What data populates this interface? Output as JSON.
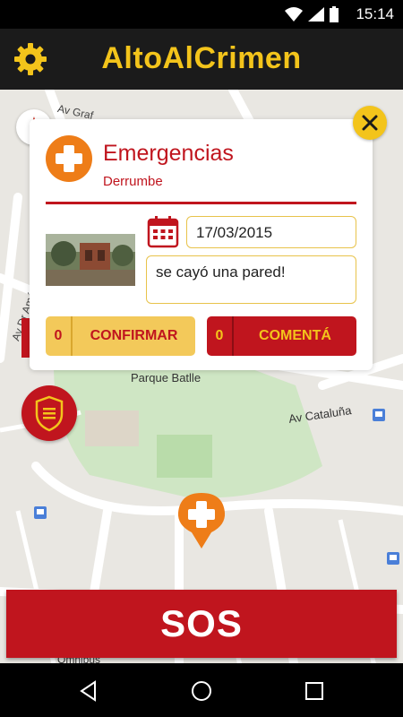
{
  "status_bar": {
    "time": "15:14"
  },
  "app_bar": {
    "title": "AltoAlCrimen",
    "settings_icon": "gear-icon"
  },
  "map": {
    "labels": {
      "park": "Parque Batlle",
      "street_cataluna": "Av Cataluña",
      "street_graf": "Av Graf",
      "street_americas": "Av Dr Améric",
      "omnibus": "Omnibus"
    }
  },
  "incident_card": {
    "category": "Emergencias",
    "subcategory": "Derrumbe",
    "date": "17/03/2015",
    "comment": "se cayó una pared!",
    "confirm": {
      "count": "0",
      "label": "CONFIRMAR"
    },
    "comment_button": {
      "count": "0",
      "label": "COMENTÁ"
    }
  },
  "sos_button": {
    "label": "SOS"
  },
  "colors": {
    "brand_red": "#c0151e",
    "brand_yellow": "#f3c41b",
    "emergency_orange": "#ee7d18"
  }
}
